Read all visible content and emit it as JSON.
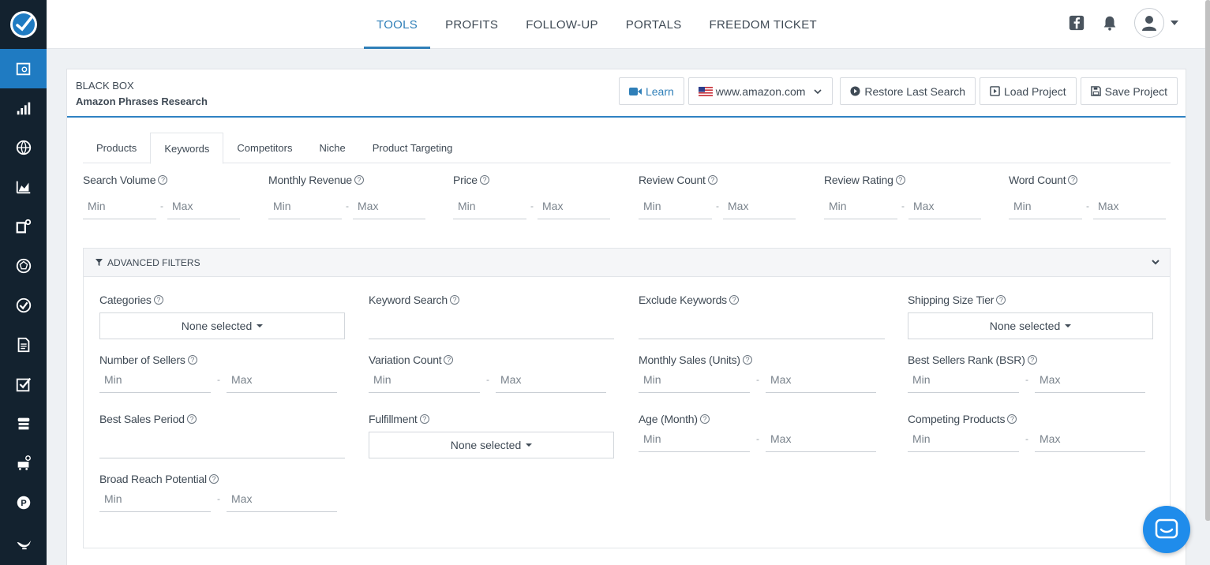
{
  "nav": {
    "tabs": [
      {
        "label": "TOOLS"
      },
      {
        "label": "PROFITS"
      },
      {
        "label": "FOLLOW-UP"
      },
      {
        "label": "PORTALS"
      },
      {
        "label": "FREEDOM TICKET"
      }
    ],
    "active_tab": "TOOLS"
  },
  "header": {
    "title": "BLACK BOX",
    "subtitle": "Amazon Phrases Research",
    "learn_label": "Learn",
    "marketplace": "www.amazon.com",
    "restore_label": "Restore Last Search",
    "load_label": "Load Project",
    "save_label": "Save Project"
  },
  "subtabs": [
    {
      "label": "Products"
    },
    {
      "label": "Keywords"
    },
    {
      "label": "Competitors"
    },
    {
      "label": "Niche"
    },
    {
      "label": "Product Targeting"
    }
  ],
  "active_subtab": "Keywords",
  "basic_filters": [
    {
      "label": "Search Volume"
    },
    {
      "label": "Monthly Revenue"
    },
    {
      "label": "Price"
    },
    {
      "label": "Review Count"
    },
    {
      "label": "Review Rating"
    },
    {
      "label": "Word Count"
    }
  ],
  "range": {
    "min_placeholder": "Min",
    "max_placeholder": "Max",
    "dash": "-"
  },
  "advanced": {
    "title": "ADVANCED FILTERS",
    "categories": {
      "label": "Categories",
      "value": "None selected"
    },
    "keyword_search": {
      "label": "Keyword Search"
    },
    "exclude_keywords": {
      "label": "Exclude Keywords"
    },
    "shipping_size_tier": {
      "label": "Shipping Size Tier",
      "value": "None selected"
    },
    "number_of_sellers": {
      "label": "Number of Sellers"
    },
    "variation_count": {
      "label": "Variation Count"
    },
    "monthly_sales": {
      "label": "Monthly Sales (Units)"
    },
    "bsr": {
      "label": "Best Sellers Rank (BSR)"
    },
    "best_sales_period": {
      "label": "Best Sales Period"
    },
    "fulfillment": {
      "label": "Fulfillment",
      "value": "None selected"
    },
    "age": {
      "label": "Age (Month)"
    },
    "competing_products": {
      "label": "Competing Products"
    },
    "broad_reach": {
      "label": "Broad Reach Potential"
    }
  },
  "colors": {
    "accent": "#2f7fb8",
    "sidebar": "#13222f",
    "sidebar_active": "#1f7bc2",
    "chat": "#1f8ceb"
  }
}
